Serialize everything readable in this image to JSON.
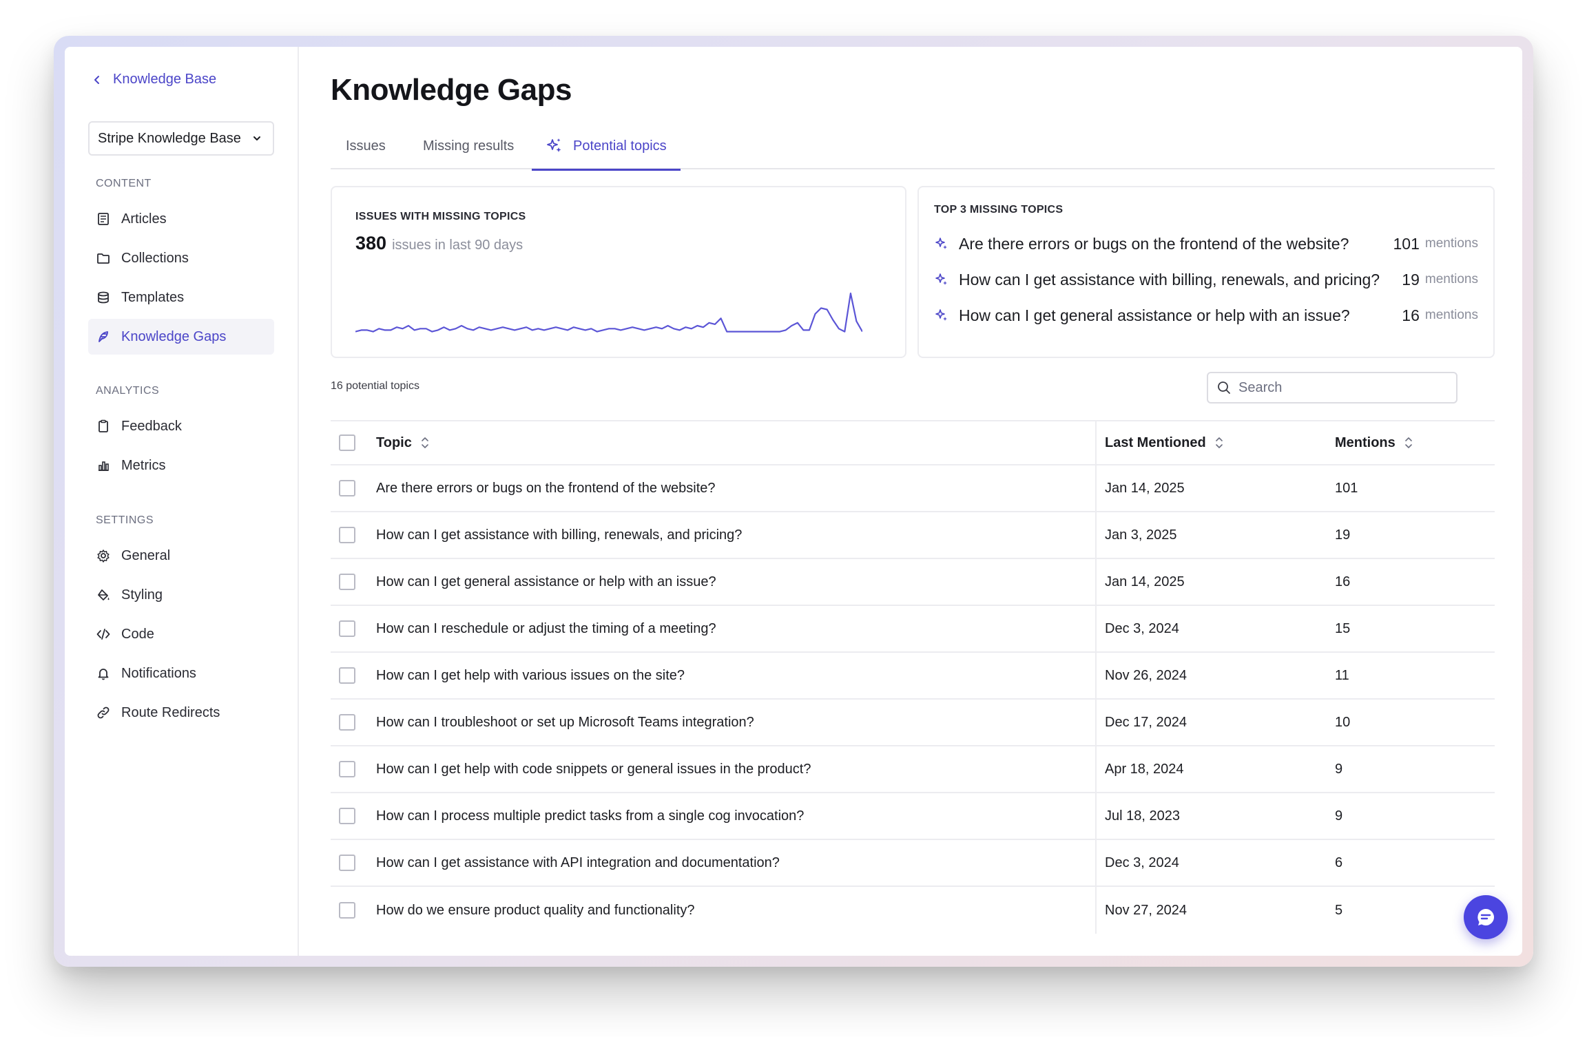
{
  "sidebar": {
    "back_label": "Knowledge Base",
    "kb_select": "Stripe Knowledge Base",
    "sections": {
      "content": "CONTENT",
      "analytics": "ANALYTICS",
      "settings": "SETTINGS"
    },
    "content_items": [
      {
        "label": "Articles",
        "icon": "articles-icon"
      },
      {
        "label": "Collections",
        "icon": "folder-icon"
      },
      {
        "label": "Templates",
        "icon": "database-icon"
      },
      {
        "label": "Knowledge Gaps",
        "icon": "feather-icon",
        "active": true
      }
    ],
    "analytics_items": [
      {
        "label": "Feedback",
        "icon": "clipboard-icon"
      },
      {
        "label": "Metrics",
        "icon": "bar-chart-icon"
      }
    ],
    "settings_items": [
      {
        "label": "General",
        "icon": "gear-icon"
      },
      {
        "label": "Styling",
        "icon": "paint-bucket-icon"
      },
      {
        "label": "Code",
        "icon": "code-icon"
      },
      {
        "label": "Notifications",
        "icon": "bell-icon"
      },
      {
        "label": "Route Redirects",
        "icon": "link-icon"
      }
    ]
  },
  "main": {
    "title": "Knowledge Gaps",
    "tabs": [
      {
        "label": "Issues"
      },
      {
        "label": "Missing results"
      },
      {
        "label": "Potential topics",
        "active": true,
        "icon": "sparkle-icon"
      }
    ],
    "issues_card": {
      "label": "ISSUES WITH MISSING TOPICS",
      "count": "380",
      "sub": "issues in last 90 days",
      "sparkline": [
        3,
        4,
        4,
        3,
        5,
        4,
        4,
        6,
        5,
        7,
        4,
        5,
        5,
        3,
        4,
        6,
        4,
        5,
        7,
        5,
        4,
        6,
        5,
        4,
        5,
        6,
        5,
        4,
        5,
        6,
        4,
        5,
        4,
        5,
        6,
        5,
        4,
        6,
        5,
        4,
        5,
        3,
        4,
        5,
        5,
        4,
        5,
        6,
        5,
        4,
        5,
        6,
        5,
        7,
        5,
        4,
        6,
        5,
        7,
        6,
        9,
        8,
        12,
        3,
        3,
        3,
        3,
        3,
        3,
        3,
        3,
        3,
        3,
        4,
        7,
        9,
        4,
        4,
        15,
        19,
        18,
        11,
        5,
        3,
        29,
        10,
        3
      ]
    },
    "top_card": {
      "label": "TOP 3 MISSING TOPICS",
      "items": [
        {
          "text": "Are there errors or bugs on the frontend of the website?",
          "count": "101",
          "unit": "mentions"
        },
        {
          "text": "How can I get assistance with billing, renewals, and pricing?",
          "count": "19",
          "unit": "mentions"
        },
        {
          "text": "How can I get general assistance or help with an issue?",
          "count": "16",
          "unit": "mentions"
        }
      ]
    },
    "count_label": "16 potential topics",
    "search_placeholder": "Search",
    "table": {
      "headers": {
        "topic": "Topic",
        "last": "Last Mentioned",
        "mentions": "Mentions"
      },
      "rows": [
        {
          "topic": "Are there errors or bugs on the frontend of the website?",
          "last": "Jan 14, 2025",
          "mentions": "101"
        },
        {
          "topic": "How can I get assistance with billing, renewals, and pricing?",
          "last": "Jan 3, 2025",
          "mentions": "19"
        },
        {
          "topic": "How can I get general assistance or help with an issue?",
          "last": "Jan 14, 2025",
          "mentions": "16"
        },
        {
          "topic": "How can I reschedule or adjust the timing of a meeting?",
          "last": "Dec 3, 2024",
          "mentions": "15"
        },
        {
          "topic": "How can I get help with various issues on the site?",
          "last": "Nov 26, 2024",
          "mentions": "11"
        },
        {
          "topic": "How can I troubleshoot or set up Microsoft Teams integration?",
          "last": "Dec 17, 2024",
          "mentions": "10"
        },
        {
          "topic": "How can I get help with code snippets or general issues in the product?",
          "last": "Apr 18, 2024",
          "mentions": "9"
        },
        {
          "topic": "How can I process multiple predict tasks from a single cog invocation?",
          "last": "Jul 18, 2023",
          "mentions": "9"
        },
        {
          "topic": "How can I get assistance with API integration and documentation?",
          "last": "Dec 3, 2024",
          "mentions": "6"
        },
        {
          "topic": "How do we ensure product quality and functionality?",
          "last": "Nov 27, 2024",
          "mentions": "5"
        }
      ]
    }
  },
  "colors": {
    "accent": "#4b45c8",
    "fab": "#4b45e0",
    "sparkline": "#5b55d6"
  }
}
